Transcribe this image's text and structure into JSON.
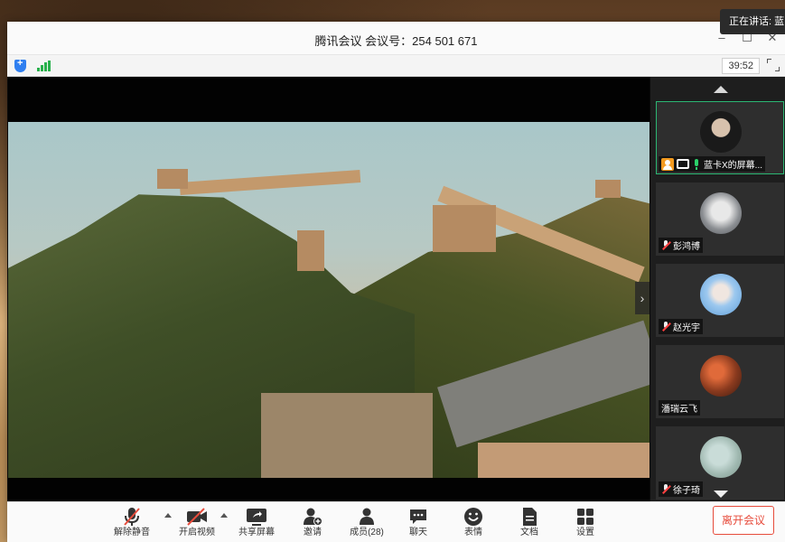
{
  "speaking_tip": "正在讲话: 蓝",
  "window": {
    "title": "腾讯会议 会议号：254 501 671",
    "controls": [
      "–",
      "☐",
      "✕"
    ]
  },
  "infobar": {
    "timer": "39:52"
  },
  "sidebar": {
    "participants": [
      {
        "name": "蓝卡X的屏幕...",
        "mic": "on",
        "active": true,
        "sharing": true
      },
      {
        "name": "彭鸿博",
        "mic": "muted",
        "active": false
      },
      {
        "name": "赵光宇",
        "mic": "muted",
        "active": false
      },
      {
        "name": "潘瑞云飞",
        "mic": "none",
        "active": false
      },
      {
        "name": "徐子琦",
        "mic": "muted",
        "active": false
      }
    ]
  },
  "toolbar": {
    "unmute": "解除静音",
    "start_video": "开启视频",
    "share_screen": "共享屏幕",
    "invite": "邀请",
    "members": "成员(28)",
    "chat": "聊天",
    "reactions": "表情",
    "docs": "文档",
    "settings": "设置",
    "leave": "离开会议"
  },
  "colors": {
    "accent_green": "#2bb673",
    "leave_red": "#e74c3c",
    "host_orange": "#f39a1f"
  }
}
